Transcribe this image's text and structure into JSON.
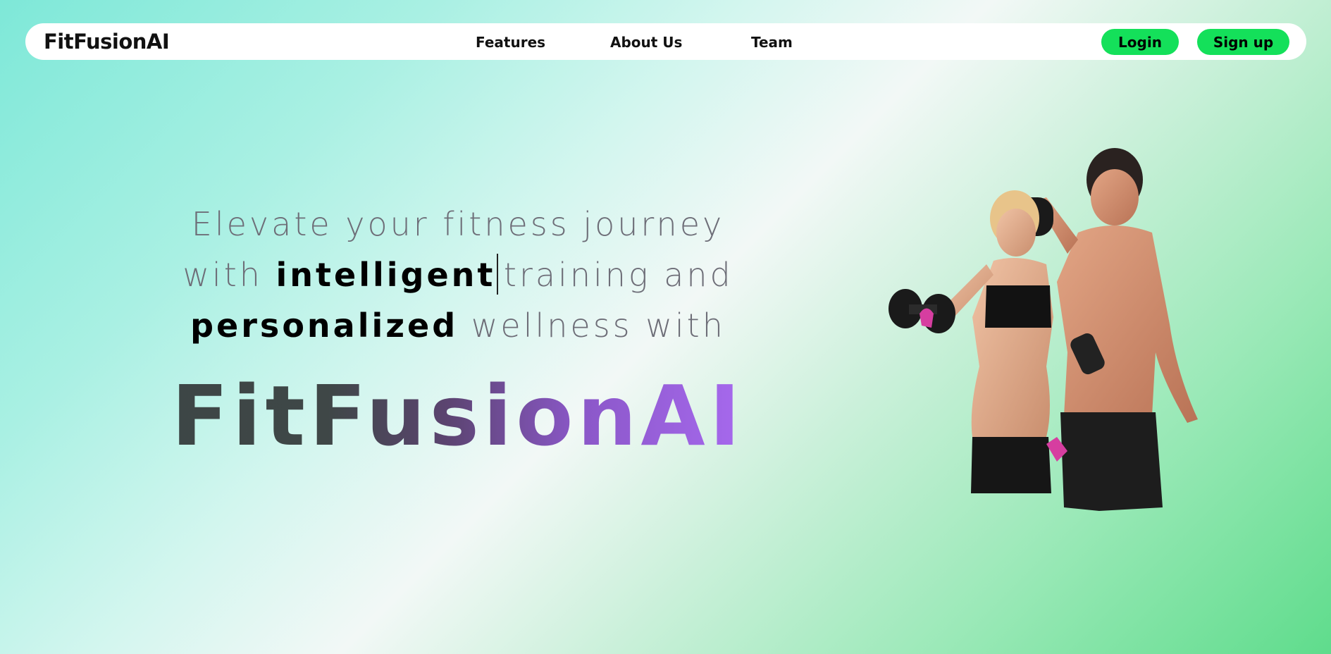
{
  "nav": {
    "brand": "FitFusionAI",
    "links": [
      "Features",
      "About Us",
      "Team"
    ],
    "login": "Login",
    "signup": "Sign up"
  },
  "hero": {
    "line1": "Elevate your fitness journey",
    "line2_pre": "with ",
    "line2_bold": "intelligent",
    "line2_post": "training and",
    "line3_bold": "personalized",
    "line3_post": " wellness with",
    "brand_big": "FitFusionAI"
  },
  "image": {
    "subject": "fitness-couple-with-dumbbells",
    "accent_colors": [
      "#d63ea0",
      "#1a1a1a"
    ]
  },
  "colors": {
    "button": "#14e05a",
    "gradient_start": "#3d4646",
    "gradient_end": "#a86af0"
  }
}
